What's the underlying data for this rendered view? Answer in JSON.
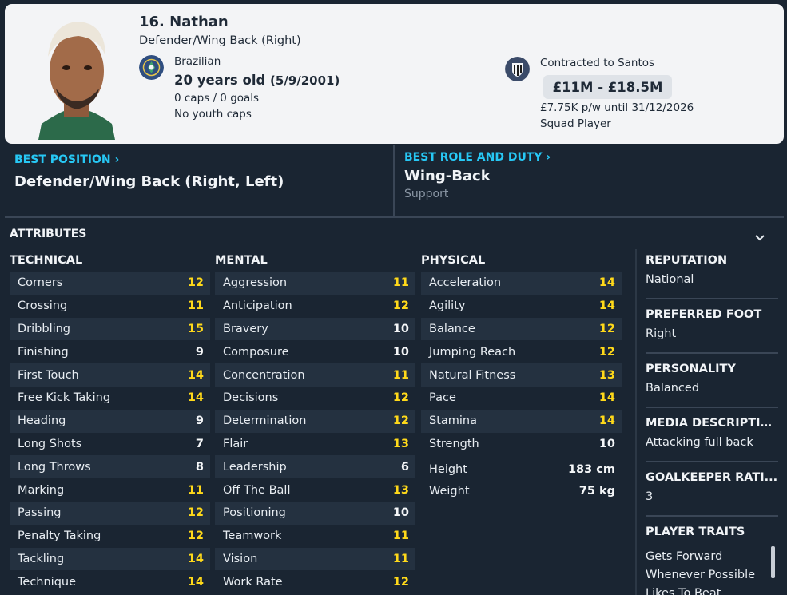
{
  "player": {
    "name": "16. Nathan",
    "position": "Defender/Wing Back (Right)",
    "nationality": "Brazilian",
    "age": "20 years old",
    "dob": "(5/9/2001)",
    "caps": "0 caps / 0 goals",
    "youth_caps": "No youth caps",
    "contract": "Contracted to Santos",
    "value": "£11M - £18.5M",
    "wage": "£7.75K p/w until 31/12/2026",
    "squad_status": "Squad Player"
  },
  "best_position": {
    "heading": "BEST POSITION",
    "value": "Defender/Wing Back (Right, Left)"
  },
  "best_role": {
    "heading": "BEST ROLE AND DUTY",
    "value": "Wing-Back",
    "duty": "Support"
  },
  "attributes": {
    "title": "ATTRIBUTES",
    "technical": {
      "heading": "TECHNICAL",
      "items": [
        {
          "label": "Corners",
          "value": "12"
        },
        {
          "label": "Crossing",
          "value": "11"
        },
        {
          "label": "Dribbling",
          "value": "15"
        },
        {
          "label": "Finishing",
          "value": "9"
        },
        {
          "label": "First Touch",
          "value": "14"
        },
        {
          "label": "Free Kick Taking",
          "value": "14"
        },
        {
          "label": "Heading",
          "value": "9"
        },
        {
          "label": "Long Shots",
          "value": "7"
        },
        {
          "label": "Long Throws",
          "value": "8"
        },
        {
          "label": "Marking",
          "value": "11"
        },
        {
          "label": "Passing",
          "value": "12"
        },
        {
          "label": "Penalty Taking",
          "value": "12"
        },
        {
          "label": "Tackling",
          "value": "14"
        },
        {
          "label": "Technique",
          "value": "14"
        }
      ]
    },
    "mental": {
      "heading": "MENTAL",
      "items": [
        {
          "label": "Aggression",
          "value": "11"
        },
        {
          "label": "Anticipation",
          "value": "12"
        },
        {
          "label": "Bravery",
          "value": "10"
        },
        {
          "label": "Composure",
          "value": "10"
        },
        {
          "label": "Concentration",
          "value": "11"
        },
        {
          "label": "Decisions",
          "value": "12"
        },
        {
          "label": "Determination",
          "value": "12"
        },
        {
          "label": "Flair",
          "value": "13"
        },
        {
          "label": "Leadership",
          "value": "6"
        },
        {
          "label": "Off The Ball",
          "value": "13"
        },
        {
          "label": "Positioning",
          "value": "10"
        },
        {
          "label": "Teamwork",
          "value": "11"
        },
        {
          "label": "Vision",
          "value": "11"
        },
        {
          "label": "Work Rate",
          "value": "12"
        }
      ]
    },
    "physical": {
      "heading": "PHYSICAL",
      "items": [
        {
          "label": "Acceleration",
          "value": "14"
        },
        {
          "label": "Agility",
          "value": "14"
        },
        {
          "label": "Balance",
          "value": "12"
        },
        {
          "label": "Jumping Reach",
          "value": "12"
        },
        {
          "label": "Natural Fitness",
          "value": "13"
        },
        {
          "label": "Pace",
          "value": "14"
        },
        {
          "label": "Stamina",
          "value": "14"
        },
        {
          "label": "Strength",
          "value": "10"
        }
      ],
      "height_label": "Height",
      "height": "183 cm",
      "weight_label": "Weight",
      "weight": "75 kg"
    }
  },
  "side": {
    "reputation_label": "REPUTATION",
    "reputation": "National",
    "foot_label": "PREFERRED FOOT",
    "foot": "Right",
    "personality_label": "PERSONALITY",
    "personality": "Balanced",
    "media_label": "MEDIA DESCRIPTION",
    "media": "Attacking full back",
    "gk_label": "GOALKEEPER RATI...",
    "gk": "3",
    "traits_label": "PLAYER TRAITS",
    "traits": [
      "Gets Forward Whenever Possible",
      "Likes To Beat"
    ]
  },
  "colors": {
    "background": "#1a2532",
    "accent_link": "#27c8f5",
    "value_high": "#ffd91a",
    "value_mid": "#f4f6f8"
  },
  "icons": {
    "collapse": "chevron-down-icon",
    "nationality": "brazil-federation-badge",
    "club": "santos-club-badge"
  }
}
